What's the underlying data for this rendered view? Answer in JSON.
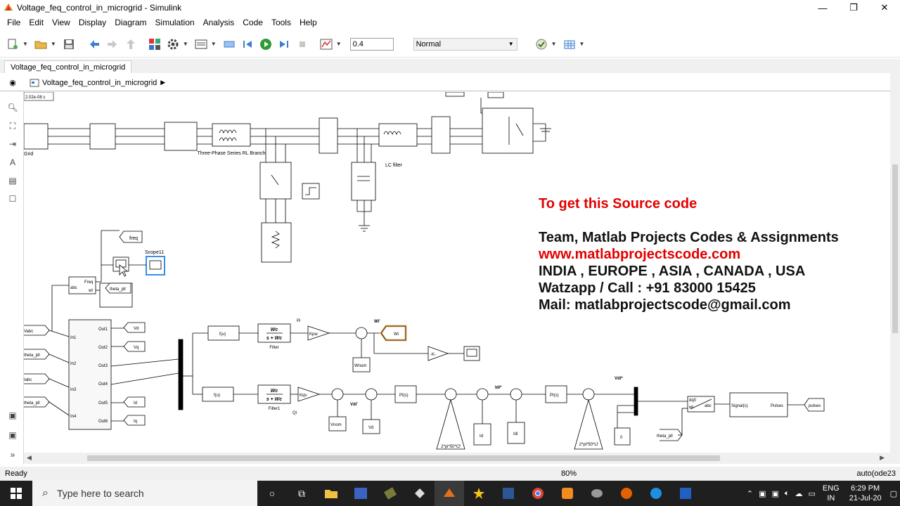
{
  "window": {
    "title": "Voltage_feq_control_in_microgrid - Simulink",
    "controls": {
      "minimize": "—",
      "maximize": "❐",
      "close": "✕"
    }
  },
  "menu": [
    "File",
    "Edit",
    "View",
    "Display",
    "Diagram",
    "Simulation",
    "Analysis",
    "Code",
    "Tools",
    "Help"
  ],
  "toolbar": {
    "stop_time": "0.4",
    "sim_mode": "Normal"
  },
  "tab": {
    "label": "Voltage_feq_control_in_microgrid"
  },
  "breadcrumb": {
    "label": "Voltage_feq_control_in_microgrid"
  },
  "model": {
    "time_label": "2.02e-08 s",
    "grid_label": "Grid",
    "rl_branch_label": "Three-Phase Series RL Branch",
    "lc_filter_label": "LC filter",
    "freq_goto": "freq",
    "scope_label": "Scope11",
    "pll_block": {
      "in": "abc",
      "out1": "Freq",
      "out2": "wt"
    },
    "theta_goto": "theta_pll",
    "left_inputs": [
      "Vabc",
      "theta_pll",
      "Iabc",
      "theta_pll"
    ],
    "subsys_inputs": [
      "In1",
      "In2",
      "In3",
      "In4"
    ],
    "subsys_outputs": [
      "Out1",
      "Out2",
      "Out3",
      "Out4",
      "Out5",
      "Out6"
    ],
    "out_gotos": [
      "Vd",
      "Vq",
      "Id",
      "Iq"
    ],
    "fcn": "f(u)",
    "filter_num": "Wc",
    "filter_den": "s + Wc",
    "filter1_label": "Filter",
    "filter2_label": "Filter1",
    "p_label": "Pi",
    "q_label": "Qi",
    "kpw": "Kpw",
    "kqv": "Kqv",
    "wnom": "Wnom",
    "vnom": "Vnom",
    "wi_label": "Wi'",
    "wi_goto": "Wi",
    "k_gain": "-K-",
    "vdi_label": "Vdi'",
    "vd_from": "Vd",
    "pi_block": "PI(s)",
    "idi_label": "Idi*",
    "id_from": "Id",
    "idi_from": "Idi",
    "gain1": "2*pi*50*Cf",
    "gain2": "2*pi*50*Lf",
    "vdi_star": "Vdi*",
    "zero": "0",
    "theta_from": "theta_pll",
    "dq0_in1": "dq0",
    "dq0_in2": "wt",
    "dq0_out": "abc",
    "pwm_in": "Signal(s)",
    "pwm_out": "Pulses",
    "pulses_goto": "pulses"
  },
  "promo": {
    "line1": "To get this Source code",
    "line2": "Team, Matlab Projects Codes & Assignments",
    "line3": "www.matlabprojectscode.com",
    "line4": "INDIA , EUROPE , ASIA , CANADA , USA",
    "line5": "Watzapp / Call : +91 83000 15425",
    "line6": "Mail: matlabprojectscode@gmail.com"
  },
  "status": {
    "left": "Ready",
    "zoom": "80%",
    "solver": "auto(ode23"
  },
  "taskbar": {
    "search_placeholder": "Type here to search",
    "lang_line1": "ENG",
    "lang_line2": "IN",
    "time": "6:29 PM",
    "date": "21-Jul-20"
  },
  "colors": {
    "promo_red": "#e30000",
    "taskbar": "#1f1f1f",
    "selected_scope": "#3a8ee6",
    "highlight": "#f3b86d"
  }
}
